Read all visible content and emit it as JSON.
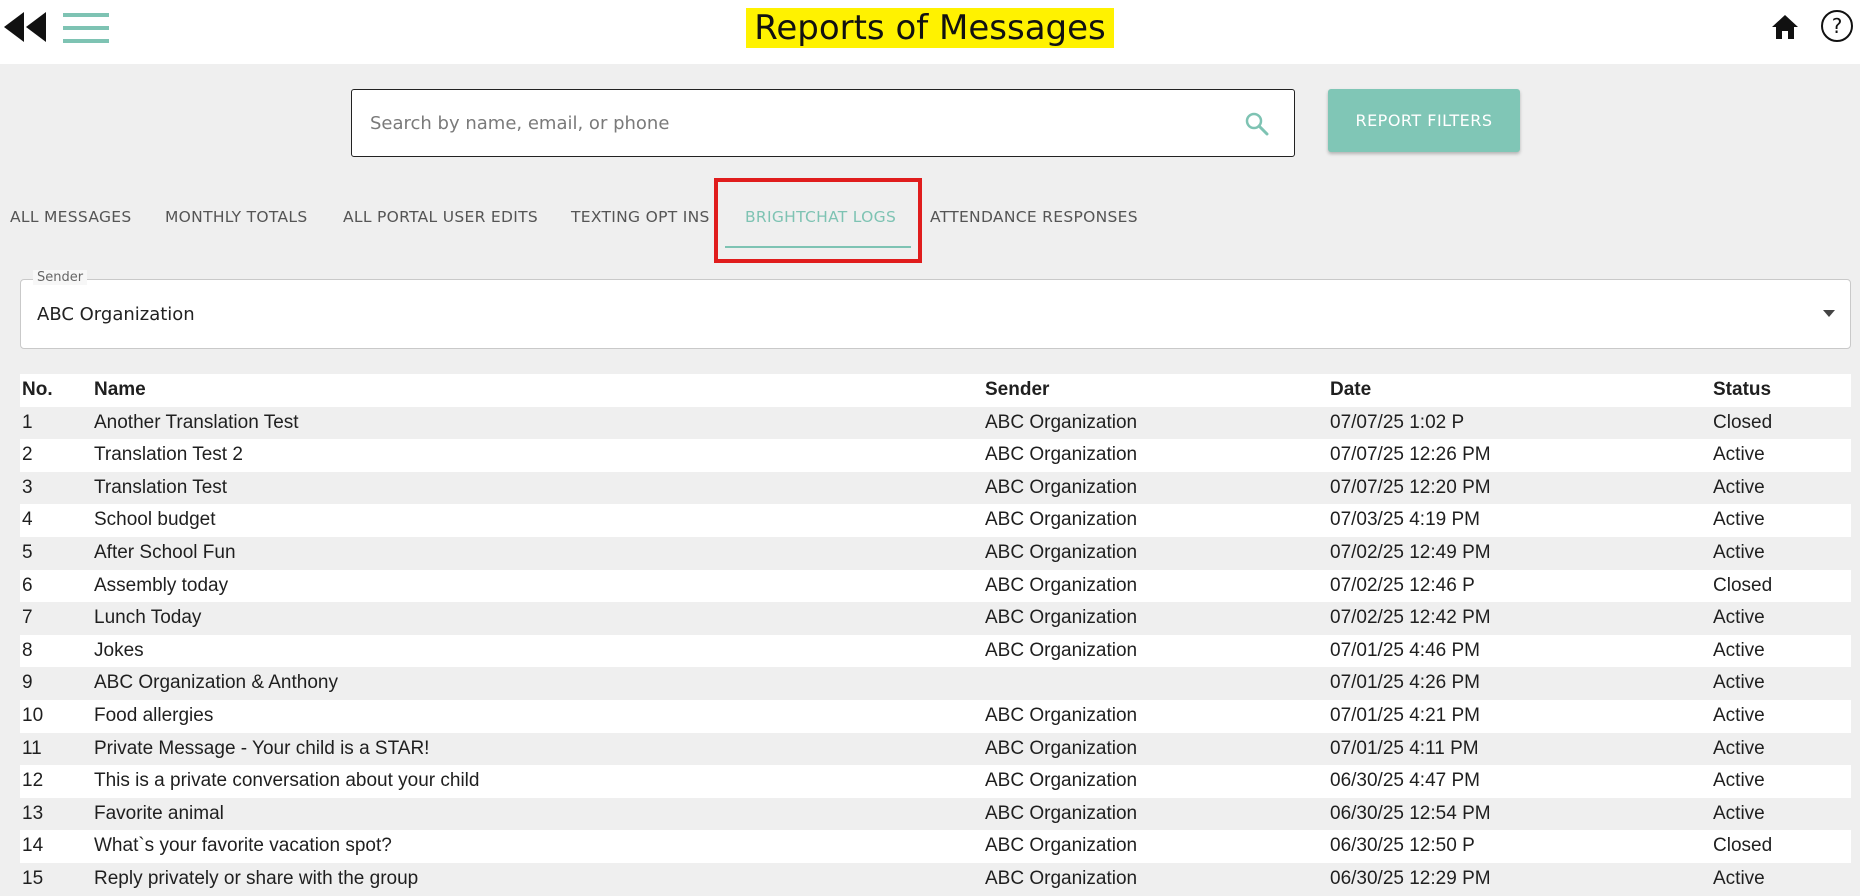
{
  "header": {
    "title": "Reports of Messages"
  },
  "icons": {
    "back": "double-chevron-left-icon",
    "menu": "hamburger-menu-icon",
    "home": "home-icon",
    "help": "help-circle-icon",
    "search": "search-icon",
    "dropdown": "caret-down-icon"
  },
  "colors": {
    "accent": "#7ec3b3",
    "title_highlight": "#fff200",
    "filters_button": "#80c6b6",
    "annotation_box": "#e01c1c"
  },
  "search": {
    "placeholder": "Search by name, email, or phone",
    "value": ""
  },
  "filters_button": {
    "label": "REPORT FILTERS"
  },
  "tabs": [
    {
      "label": "ALL MESSAGES",
      "active": false
    },
    {
      "label": "MONTHLY TOTALS",
      "active": false
    },
    {
      "label": "ALL PORTAL USER EDITS",
      "active": false
    },
    {
      "label": "TEXTING OPT INS",
      "active": false
    },
    {
      "label": "BRIGHTCHAT LOGS",
      "active": true
    },
    {
      "label": "ATTENDANCE RESPONSES",
      "active": false
    }
  ],
  "sender_filter": {
    "label": "Sender",
    "value": "ABC Organization"
  },
  "table": {
    "columns": [
      "No.",
      "Name",
      "Sender",
      "Date",
      "Status"
    ],
    "rows": [
      [
        "1",
        "Another Translation Test",
        "ABC Organization",
        "07/07/25 1:02 P",
        "Closed"
      ],
      [
        "2",
        "Translation Test 2",
        "ABC Organization",
        "07/07/25 12:26 PM",
        "Active"
      ],
      [
        "3",
        "Translation Test",
        "ABC Organization",
        "07/07/25 12:20 PM",
        "Active"
      ],
      [
        "4",
        "School budget",
        "ABC Organization",
        "07/03/25 4:19 PM",
        "Active"
      ],
      [
        "5",
        "After School Fun",
        "ABC Organization",
        "07/02/25 12:49 PM",
        "Active"
      ],
      [
        "6",
        "Assembly today",
        "ABC Organization",
        "07/02/25 12:46 P",
        "Closed"
      ],
      [
        "7",
        "Lunch Today",
        "ABC Organization",
        "07/02/25 12:42 PM",
        "Active"
      ],
      [
        "8",
        "Jokes",
        "ABC Organization",
        "07/01/25 4:46 PM",
        "Active"
      ],
      [
        "9",
        "ABC Organization & Anthony",
        "",
        "07/01/25 4:26 PM",
        "Active"
      ],
      [
        "10",
        "Food allergies",
        "ABC Organization",
        "07/01/25 4:21 PM",
        "Active"
      ],
      [
        "11",
        "Private Message - Your child is a STAR!",
        "ABC Organization",
        "07/01/25 4:11 PM",
        "Active"
      ],
      [
        "12",
        "This is a private conversation about your child",
        "ABC Organization",
        "06/30/25 4:47 PM",
        "Active"
      ],
      [
        "13",
        "Favorite animal",
        "ABC Organization",
        "06/30/25 12:54 PM",
        "Active"
      ],
      [
        "14",
        "What`s your favorite vacation spot?",
        "ABC Organization",
        "06/30/25 12:50 P",
        "Closed"
      ],
      [
        "15",
        "Reply privately or share with the group",
        "ABC Organization",
        "06/30/25 12:29 PM",
        "Active"
      ]
    ]
  }
}
